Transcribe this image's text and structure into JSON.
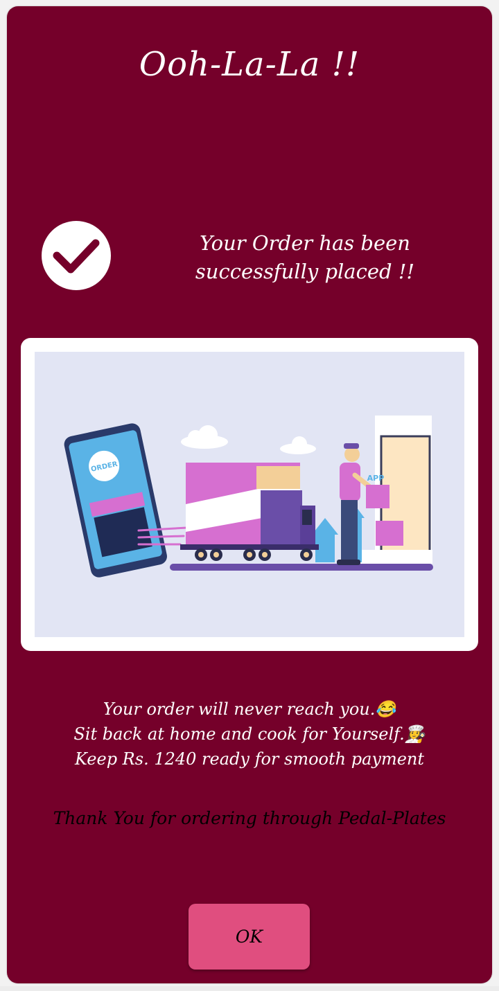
{
  "dialog": {
    "title": "Ooh-La-La !!",
    "success_message": {
      "line1": "Your Order has been",
      "line2": "successfully placed !!"
    },
    "illustration": {
      "icon": "delivery-illustration",
      "phone_badge_text": "ORDER",
      "bag_badge_text": "APP"
    },
    "info": {
      "line1": "Your order will never reach you.😂",
      "line2": "Sit back at home and cook for Yourself.👩‍🍳",
      "line3": "Keep Rs. 1240 ready for smooth payment"
    },
    "thanks": "Thank You for ordering through Pedal-Plates",
    "ok_label": "OK"
  },
  "colors": {
    "background": "#75002a",
    "button": "#e04e7f",
    "text": "#ffffff"
  }
}
